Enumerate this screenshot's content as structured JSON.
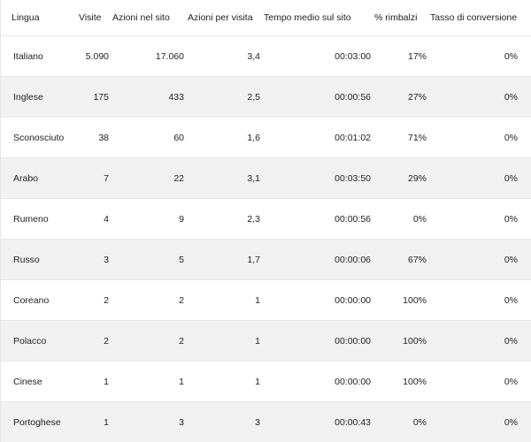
{
  "table": {
    "headers": [
      "Lingua",
      "Visite",
      "Azioni nel sito",
      "Azioni per visita",
      "Tempo medio sul sito",
      "% rimbalzi",
      "Tasso di conversione"
    ],
    "rows": [
      [
        "Italiano",
        "5.090",
        "17.060",
        "3,4",
        "00:03:00",
        "17%",
        "0%"
      ],
      [
        "Inglese",
        "175",
        "433",
        "2,5",
        "00:00:56",
        "27%",
        "0%"
      ],
      [
        "Sconosciuto",
        "38",
        "60",
        "1,6",
        "00:01:02",
        "71%",
        "0%"
      ],
      [
        "Arabo",
        "7",
        "22",
        "3,1",
        "00:03:50",
        "29%",
        "0%"
      ],
      [
        "Rumeno",
        "4",
        "9",
        "2,3",
        "00:00:56",
        "0%",
        "0%"
      ],
      [
        "Russo",
        "3",
        "5",
        "1,7",
        "00:00:06",
        "67%",
        "0%"
      ],
      [
        "Coreano",
        "2",
        "2",
        "1",
        "00:00:00",
        "100%",
        "0%"
      ],
      [
        "Polacco",
        "2",
        "2",
        "1",
        "00:00:00",
        "100%",
        "0%"
      ],
      [
        "Cinese",
        "1",
        "1",
        "1",
        "00:00:00",
        "100%",
        "0%"
      ],
      [
        "Portoghese",
        "1",
        "3",
        "3",
        "00:00:43",
        "0%",
        "0%"
      ]
    ]
  }
}
